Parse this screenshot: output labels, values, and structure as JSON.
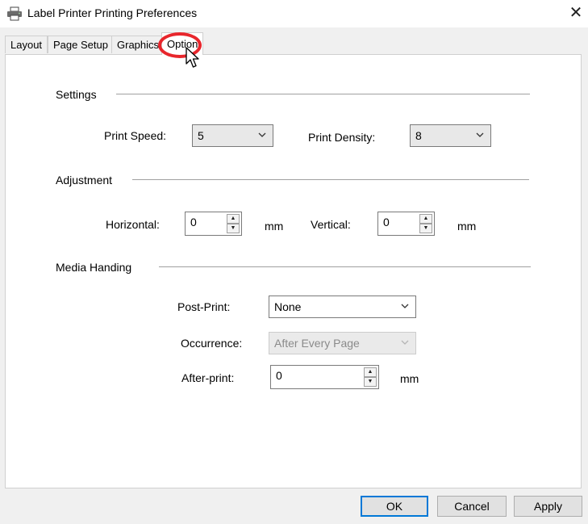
{
  "window": {
    "title": "Label Printer Printing Preferences",
    "close_glyph": "✕",
    "icon": "printer-icon"
  },
  "tabs": [
    {
      "label": "Layout",
      "active": false
    },
    {
      "label": "Page Setup",
      "active": false
    },
    {
      "label": "Graphics",
      "active": false
    },
    {
      "label": "Option",
      "active": true
    }
  ],
  "settings": {
    "title": "Settings",
    "print_speed": {
      "label": "Print Speed:",
      "value": "5"
    },
    "print_density": {
      "label": "Print Density:",
      "value": "8"
    }
  },
  "adjustment": {
    "title": "Adjustment",
    "horizontal": {
      "label": "Horizontal:",
      "value": "0",
      "unit": "mm"
    },
    "vertical": {
      "label": "Vertical:",
      "value": "0",
      "unit": "mm"
    }
  },
  "media": {
    "title": "Media Handing",
    "post_print": {
      "label": "Post-Print:",
      "value": "None"
    },
    "occurrence": {
      "label": "Occurrence:",
      "value": "After Every Page",
      "disabled": true
    },
    "after_print": {
      "label": "After-print:",
      "value": "0",
      "unit": "mm"
    }
  },
  "buttons": {
    "ok": "OK",
    "cancel": "Cancel",
    "apply": "Apply"
  },
  "colors": {
    "highlight": "#e8262c",
    "default_button_border": "#0078d7"
  }
}
